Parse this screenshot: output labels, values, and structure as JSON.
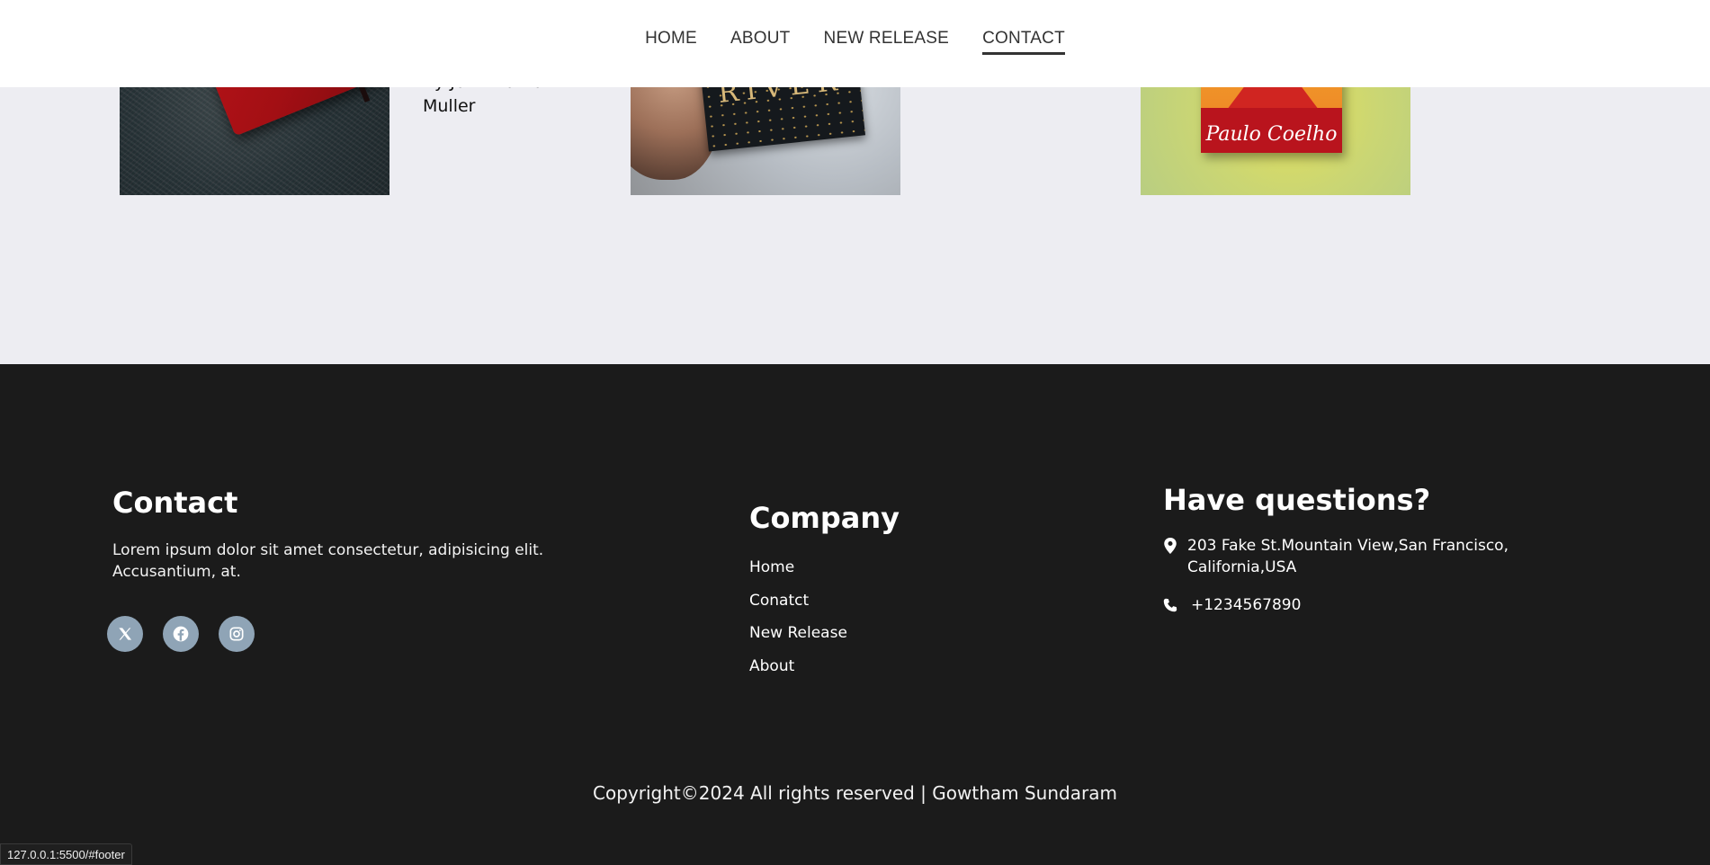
{
  "nav": {
    "items": [
      {
        "label": "HOME"
      },
      {
        "label": "ABOUT"
      },
      {
        "label": "NEW RELEASE"
      },
      {
        "label": "CONTACT",
        "active": true
      }
    ]
  },
  "books": {
    "byline": "By John Nathan Muller",
    "cover2_text": "RIVER",
    "cover3_text": "Paulo Coelho"
  },
  "footer": {
    "contact": {
      "title": "Contact",
      "text": "Lorem ipsum dolor sit amet consectetur, adipisicing elit. Accusantium, at.",
      "socials": [
        "x-icon",
        "facebook-icon",
        "instagram-icon"
      ]
    },
    "company": {
      "title": "Company",
      "links": [
        "Home",
        "Conatct",
        "New Release",
        "About"
      ]
    },
    "questions": {
      "title": "Have questions?",
      "address": "203 Fake St.Mountain View,San Francisco, California,USA",
      "phone": "+1234567890"
    },
    "copyright": "Copyright©2024 All rights reserved | Gowtham Sundaram"
  },
  "status_bar": "127.0.0.1:5500/#footer",
  "colors": {
    "footer_bg": "#1b1b1b",
    "page_bg": "#ededf2",
    "social_bg": "#8fa4b6"
  }
}
